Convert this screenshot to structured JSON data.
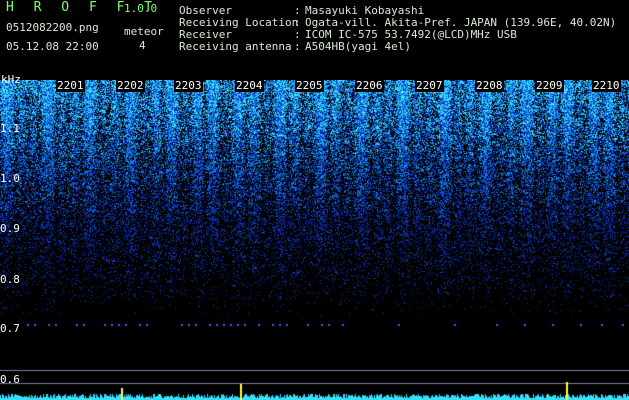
{
  "header": {
    "app_title": "H R O F F T",
    "app_version": "1.0.0",
    "file_name": "0512082200.png",
    "timestamp": "05.12.08 22:00",
    "meteor_label": "meteor",
    "meteor_count": "4"
  },
  "meta": [
    {
      "label": "Observer",
      "value": "Masayuki Kobayashi"
    },
    {
      "label": "Receiving Location",
      "value": "Ogata-vill. Akita-Pref. JAPAN (139.96E, 40.02N)"
    },
    {
      "label": "Receiver",
      "value": "ICOM IC-575 53.7492(@LCD)MHz USB"
    },
    {
      "label": "Receiving antenna",
      "value": "A504HB(yagi 4el)"
    }
  ],
  "axis": {
    "y_unit": "kHz",
    "y_ticks": [
      "1.1",
      "1.0",
      "0.9",
      "0.8",
      "0.7",
      "0.6"
    ],
    "x_hours": [
      "2201",
      "2202",
      "2203",
      "2204",
      "2205",
      "2206",
      "2207",
      "2208",
      "2209",
      "2210"
    ]
  },
  "colors": {
    "background": "#000000",
    "title": "#7dff6a",
    "noise_low": "#0a1a7a",
    "noise_high": "#35d0ff",
    "trace": "#35e0ff",
    "meteor_spike": "#ffff40"
  }
}
